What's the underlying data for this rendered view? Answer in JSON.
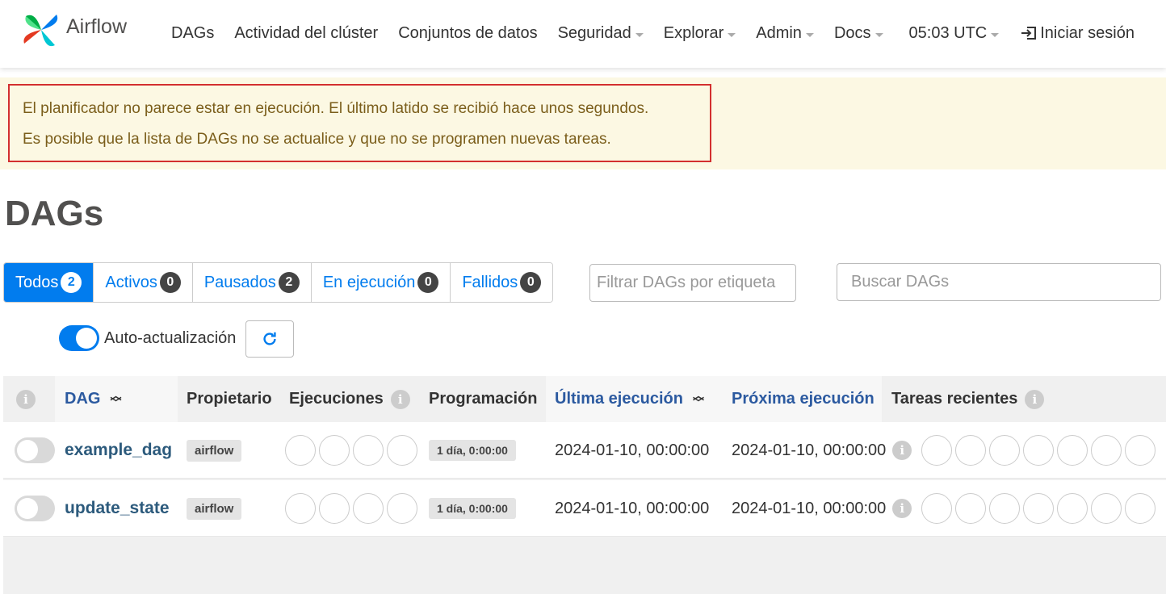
{
  "navbar": {
    "brand": "Airflow",
    "items": [
      {
        "label": "DAGs"
      },
      {
        "label": "Actividad del clúster"
      },
      {
        "label": "Conjuntos de datos"
      },
      {
        "label": "Seguridad"
      },
      {
        "label": "Explorar"
      },
      {
        "label": "Admin"
      },
      {
        "label": "Docs"
      },
      {
        "label": "05:03 UTC"
      },
      {
        "label": "Iniciar sesión"
      }
    ]
  },
  "alert": {
    "line1": "El planificador no parece estar en ejecución. El último latido se recibió hace unos segundos.",
    "line2": "Es posible que la lista de DAGs no se actualice y que no se programen nuevas tareas."
  },
  "page_title": "DAGs",
  "tabs": [
    {
      "label": "Todos",
      "count": "2"
    },
    {
      "label": "Activos",
      "count": "0"
    },
    {
      "label": "Pausados",
      "count": "2"
    },
    {
      "label": "En ejecución",
      "count": "0"
    },
    {
      "label": "Fallidos",
      "count": "0"
    }
  ],
  "filters": {
    "tag_placeholder": "Filtrar DAGs por etiqueta",
    "search_placeholder": "Buscar DAGs"
  },
  "auto_refresh": {
    "label": "Auto-actualización",
    "enabled": true
  },
  "table": {
    "headers": {
      "dag": "DAG",
      "owner": "Propietario",
      "runs": "Ejecuciones",
      "schedule": "Programación",
      "last_run": "Última ejecución",
      "next_run": "Próxima ejecución",
      "recent_tasks": "Tareas recientes"
    },
    "rows": [
      {
        "dag_id": "example_dag",
        "owner": "airflow",
        "schedule": "1 día, 0:00:00",
        "last_run": "2024-01-10, 00:00:00",
        "next_run": "2024-01-10, 00:00:00",
        "paused": true
      },
      {
        "dag_id": "update_state",
        "owner": "airflow",
        "schedule": "1 día, 0:00:00",
        "last_run": "2024-01-10, 00:00:00",
        "next_run": "2024-01-10, 00:00:00",
        "paused": true
      }
    ]
  },
  "colors": {
    "primary": "#017cee",
    "alert_border": "#d32f2f",
    "alert_bg": "#fcf8e3"
  }
}
